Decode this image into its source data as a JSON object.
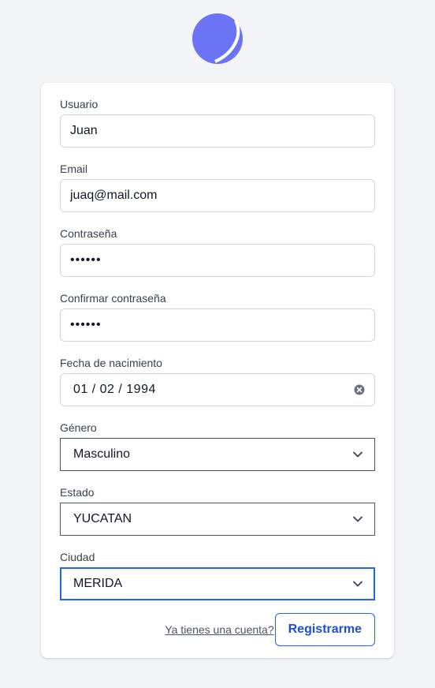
{
  "brand": {
    "logo_icon": "crescent-logo-icon",
    "logo_color": "#6b74f5"
  },
  "form": {
    "usuario": {
      "label": "Usuario",
      "value": "Juan"
    },
    "email": {
      "label": "Email",
      "value": "juaq@mail.com"
    },
    "password": {
      "label": "Contraseña",
      "value": "••••••"
    },
    "confirm_password": {
      "label": "Confirmar contraseña",
      "value": "••••••"
    },
    "birthdate": {
      "label": "Fecha de nacimiento",
      "value": "01 / 02 / 1994"
    },
    "gender": {
      "label": "Género",
      "value": "Masculino"
    },
    "state": {
      "label": "Estado",
      "value": "YUCATAN"
    },
    "city": {
      "label": "Ciudad",
      "value": "MERIDA"
    }
  },
  "footer": {
    "login_link": "Ya tienes una cuenta?",
    "register_button": "Registrarme"
  },
  "colors": {
    "accent": "#2563eb",
    "background": "#f3f4f6"
  }
}
